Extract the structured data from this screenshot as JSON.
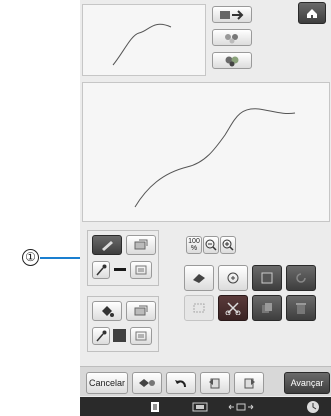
{
  "callout": {
    "number": "①"
  },
  "zoom": {
    "level_label": "100",
    "unit": "%"
  },
  "bottom_bar": {
    "cancel_label": "Cancelar",
    "next_label": "Avançar"
  },
  "colors": {
    "screen_bg": "#ececec",
    "button_dark": "#4a4a4a",
    "stroke_color": "#4a4a4a",
    "fill_swatch": "#404040",
    "callout_line": "#1a7fd0"
  },
  "icons": {
    "home": "home-icon",
    "flip": "flip-icon",
    "image_edit": "image-edit-icon",
    "image_clear": "image-clear-icon",
    "line_tool": "pen-icon",
    "line_type": "line-type-icon",
    "line_color_picker": "eyedropper-icon",
    "region_tool": "paint-bucket-icon",
    "region_type": "fill-type-icon",
    "eraser": "eraser-icon",
    "brush_select": "brush-icon",
    "scissors": "scissors-icon",
    "undo": "undo-icon",
    "memory": "memory-icon"
  }
}
